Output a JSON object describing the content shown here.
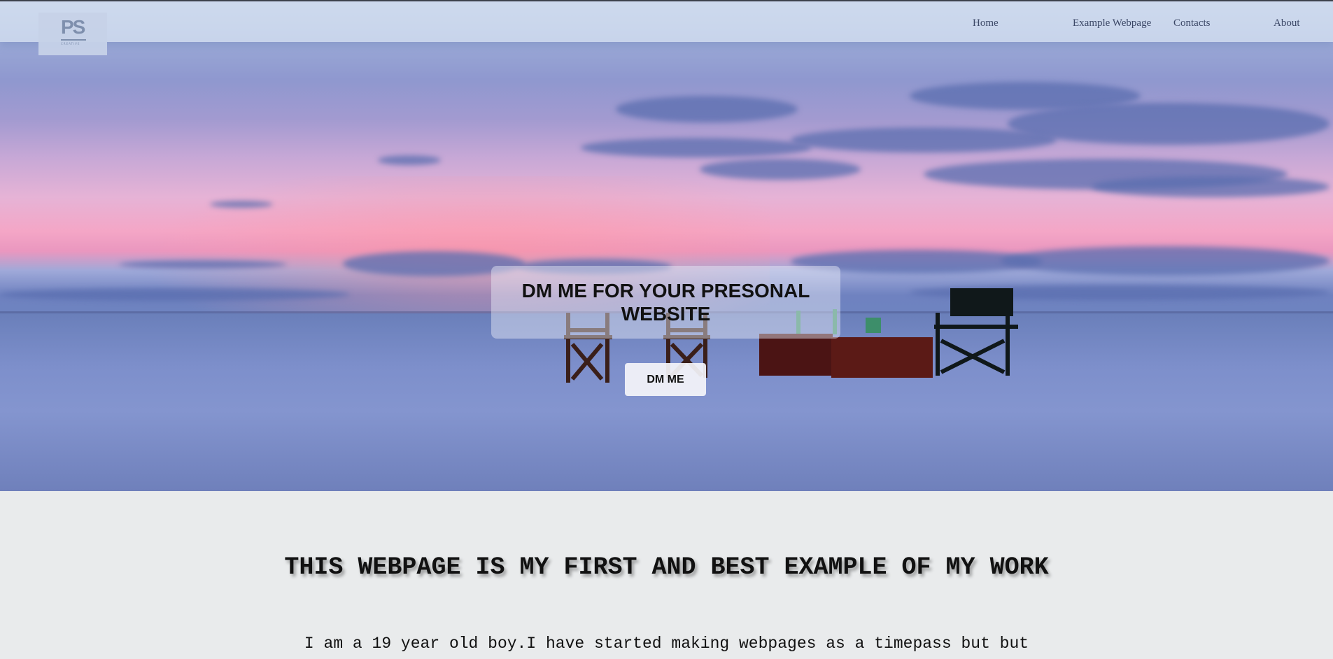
{
  "nav": {
    "logo_text": "PS",
    "logo_subtext": "CREATIVE",
    "links": [
      "Home",
      "Example Webpage",
      "Contacts",
      "About"
    ]
  },
  "hero": {
    "title": "DM ME FOR YOUR PRESONAL WEBSITE",
    "button_label": "DM ME"
  },
  "content": {
    "heading": "THIS WEBPAGE IS MY FIRST AND BEST EXAMPLE OF MY WORK",
    "text": "I am a 19 year old boy.I have started making webpages as a timepass but but"
  },
  "colors": {
    "nav_text": "#3b4766",
    "page_background": "#e9ebec"
  }
}
